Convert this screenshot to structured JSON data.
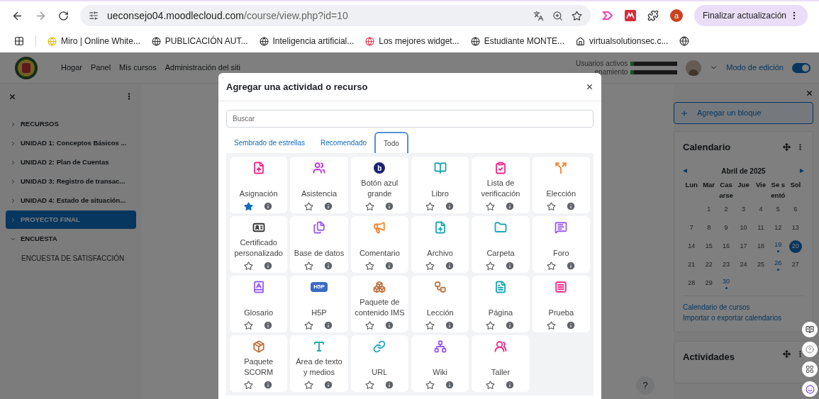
{
  "browser": {
    "url_host": "ueconsejo04.moodlecloud.com",
    "url_path": "/course/view.php?id=10",
    "profile_initial": "a",
    "update_button": "Finalizar actualización"
  },
  "bookmarks": [
    {
      "label": "Miro | Online White..."
    },
    {
      "label": "PUBLICACIÓN AUT..."
    },
    {
      "label": "Inteligencia artificial..."
    },
    {
      "label": "Los mejores widget..."
    },
    {
      "label": "Estudiante MONTE..."
    },
    {
      "label": "virtualsolutionsec.c..."
    }
  ],
  "navbar": {
    "links": [
      "Hogar",
      "Panel",
      "Mis cursos",
      "Administración del siti"
    ],
    "usage_labels": [
      "Usuarios activos",
      "enamiento"
    ],
    "edit_mode": {
      "label": "Modo de edición",
      "on": true
    }
  },
  "course_index": {
    "items": [
      {
        "label": "RECURSOS",
        "selected": false,
        "expanded": false
      },
      {
        "label": "UNIDAD 1: Conceptos Básicos ...",
        "selected": false,
        "expanded": false
      },
      {
        "label": "UNIDAD 2: Plan de Cuentas",
        "selected": false,
        "expanded": false
      },
      {
        "label": "UNIDAD 3: Registro de transac...",
        "selected": false,
        "expanded": false
      },
      {
        "label": "UNIDAD 4: Estado de situación...",
        "selected": false,
        "expanded": false
      },
      {
        "label": "PROYECTO FINAL",
        "selected": true,
        "expanded": false
      },
      {
        "label": "ENCUESTA",
        "selected": false,
        "expanded": true,
        "children": [
          {
            "label": "ENCUESTA DE SATISFACCIÓN",
            "selected": false
          }
        ]
      }
    ]
  },
  "modal": {
    "title": "Agregar una actividad o recurso",
    "search": {
      "placeholder": "Buscar"
    },
    "tabs": [
      {
        "label": "Sembrado de estrellas",
        "selected": false
      },
      {
        "label": "Recomendado",
        "selected": false
      },
      {
        "label": "Todo",
        "selected": true
      }
    ],
    "activities": [
      {
        "name": "Asignación",
        "color": "#f7268c",
        "starred": true
      },
      {
        "name": "Asistencia",
        "color": "#c62fe0",
        "starred": false
      },
      {
        "name": "Botón azul grande",
        "color": "#1d2371",
        "logo": "b",
        "starred": false
      },
      {
        "name": "Libro",
        "color": "#1ba6b5",
        "starred": false
      },
      {
        "name": "Lista de verificación",
        "color": "#f7268c",
        "starred": false
      },
      {
        "name": "Elección",
        "color": "#f7822b",
        "starred": false
      },
      {
        "name": "Certificado personalizado",
        "color": "#333333",
        "starred": false
      },
      {
        "name": "Base de datos",
        "color": "#9b5cf2",
        "starred": false
      },
      {
        "name": "Comentario",
        "color": "#f7822b",
        "starred": false
      },
      {
        "name": "Archivo",
        "color": "#1ba6b5",
        "starred": false
      },
      {
        "name": "Carpeta",
        "color": "#1ba6b5",
        "starred": false
      },
      {
        "name": "Foro",
        "color": "#9b5cf2",
        "starred": false
      },
      {
        "name": "Glosario",
        "color": "#9b5cf2",
        "starred": false
      },
      {
        "name": "H5P",
        "color": "#3a6cc2",
        "logo": "H5P",
        "starred": false
      },
      {
        "name": "Paquete de contenido IMS",
        "color": "#c0703c",
        "starred": false
      },
      {
        "name": "Lección",
        "color": "#c0703c",
        "starred": false
      },
      {
        "name": "Página",
        "color": "#1ba6b5",
        "starred": false
      },
      {
        "name": "Prueba",
        "color": "#f7268c",
        "starred": false
      },
      {
        "name": "Paquete SCORM",
        "color": "#c0703c",
        "starred": false
      },
      {
        "name": "Área de texto y medios",
        "color": "#1ba6b5",
        "starred": false
      },
      {
        "name": "URL",
        "color": "#1ba6b5",
        "starred": false
      },
      {
        "name": "Wiki",
        "color": "#9b5cf2",
        "starred": false
      },
      {
        "name": "Taller",
        "color": "#f7268c",
        "starred": false
      }
    ]
  },
  "right_drawer": {
    "add_block": "Agregar un bloque",
    "calendar": {
      "title": "Calendario",
      "month": "Abril de 2025",
      "weekdays": [
        "Lun",
        "Mar",
        "Casarse",
        "Jue",
        "Vie",
        "Se sentó",
        "Sol"
      ],
      "weeks": [
        [
          {
            "day": "1",
            "event": false,
            "today": false
          },
          {
            "day": "2",
            "event": false,
            "today": false
          },
          {
            "day": "3",
            "event": false,
            "today": false
          },
          {
            "day": "4",
            "event": false,
            "today": false
          },
          {
            "day": "5",
            "event": false,
            "today": false
          },
          {
            "day": "6",
            "event": false,
            "today": false
          }
        ],
        [
          {
            "day": "7",
            "event": false,
            "today": false
          },
          {
            "day": "8",
            "event": false,
            "today": false
          },
          {
            "day": "9",
            "event": false,
            "today": false
          },
          {
            "day": "10",
            "event": false,
            "today": false
          },
          {
            "day": "11",
            "event": false,
            "today": false
          },
          {
            "day": "12",
            "event": false,
            "today": false
          },
          {
            "day": "13",
            "event": false,
            "today": false
          }
        ],
        [
          {
            "day": "14",
            "event": false,
            "today": false
          },
          {
            "day": "15",
            "event": false,
            "today": false
          },
          {
            "day": "16",
            "event": false,
            "today": false
          },
          {
            "day": "17",
            "event": false,
            "today": false
          },
          {
            "day": "18",
            "event": false,
            "today": false
          },
          {
            "day": "19",
            "event": true,
            "today": false
          },
          {
            "day": "20",
            "event": false,
            "today": true
          }
        ],
        [
          {
            "day": "21",
            "event": false,
            "today": false
          },
          {
            "day": "22",
            "event": false,
            "today": false
          },
          {
            "day": "23",
            "event": false,
            "today": false
          },
          {
            "day": "24",
            "event": false,
            "today": false
          },
          {
            "day": "25",
            "event": false,
            "today": false
          },
          {
            "day": "26",
            "event": true,
            "today": false
          },
          {
            "day": "27",
            "event": false,
            "today": false
          }
        ],
        [
          {
            "day": "28",
            "event": false,
            "today": false
          },
          {
            "day": "29",
            "event": false,
            "today": false
          },
          {
            "day": "30",
            "event": true,
            "today": false
          }
        ]
      ],
      "links": [
        "Calendario de cursos",
        "Importar o exportar calendarios"
      ]
    },
    "next_block": "Actividades"
  },
  "help_button": "?"
}
